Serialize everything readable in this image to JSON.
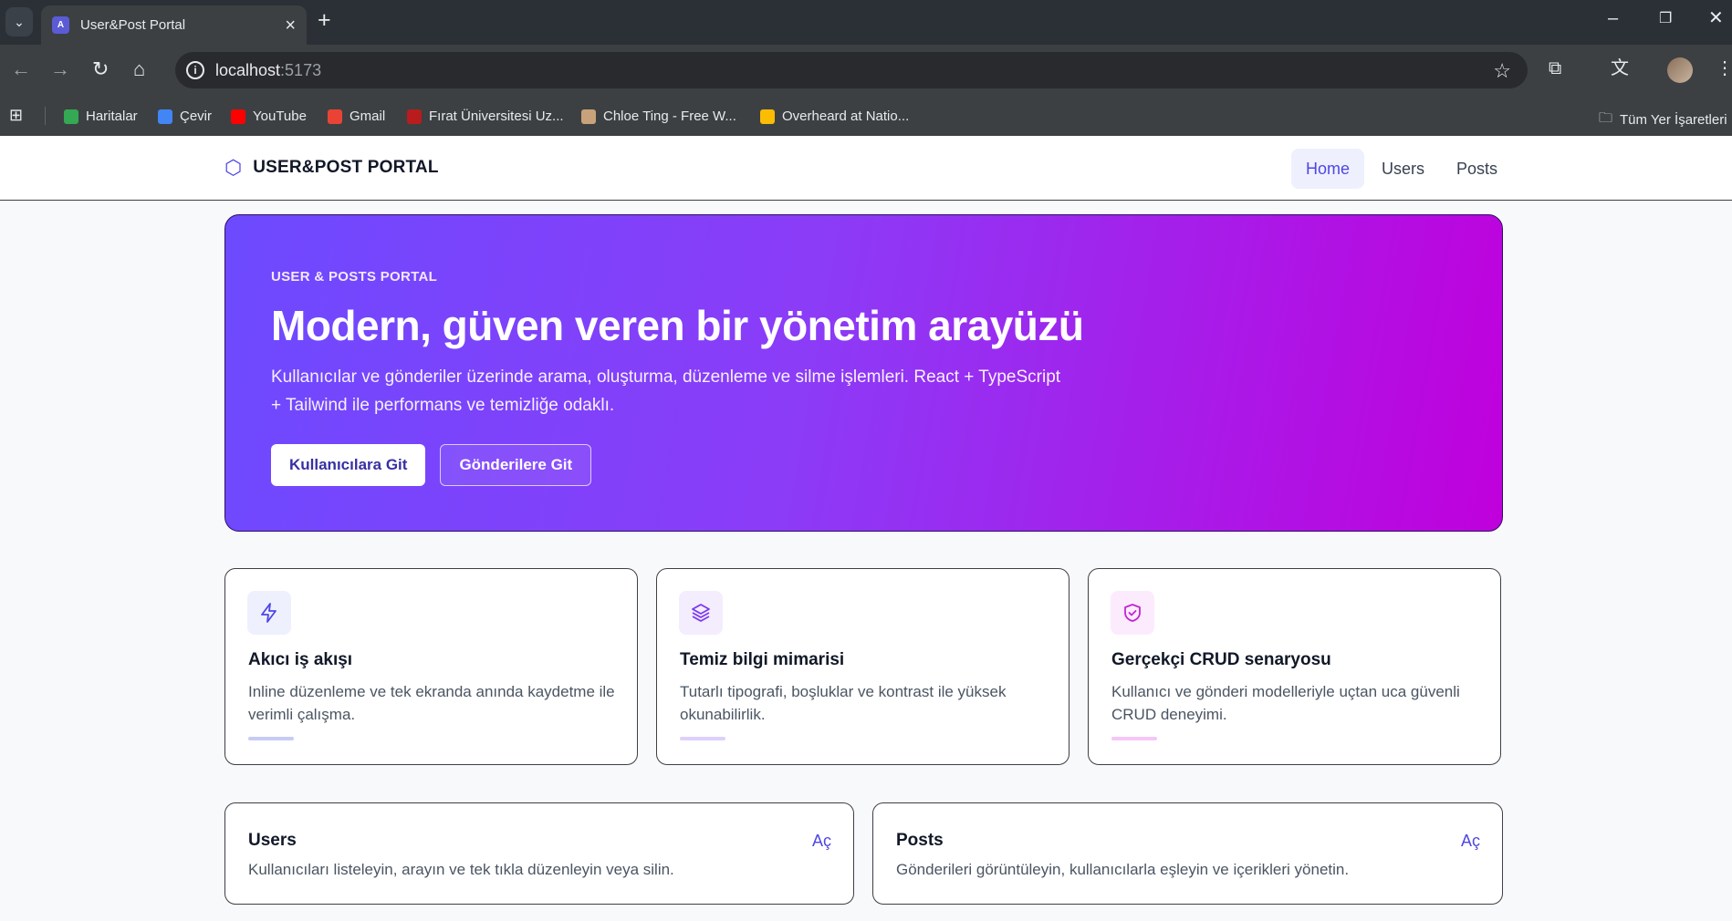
{
  "browser": {
    "tab_title": "User&Post Portal",
    "url_host": "localhost",
    "url_port": ":5173",
    "bookmarks": [
      {
        "label": "Haritalar",
        "icon": "maps-icon",
        "color": "#34a853"
      },
      {
        "label": "Çevir",
        "icon": "translate-icon",
        "color": "#4285f4"
      },
      {
        "label": "YouTube",
        "icon": "youtube-icon",
        "color": "#ff0000"
      },
      {
        "label": "Gmail",
        "icon": "gmail-icon",
        "color": "#ea4335"
      },
      {
        "label": "Fırat Üniversitesi Uz...",
        "icon": "university-icon",
        "color": "#b91c1c"
      },
      {
        "label": "Chloe Ting - Free W...",
        "icon": "chloe-ting-icon",
        "color": "#c8a27a"
      },
      {
        "label": "Overheard at Natio...",
        "icon": "natgeo-icon",
        "color": "#fbbc04"
      }
    ],
    "all_bookmarks_label": "Tüm Yer İşaretleri"
  },
  "header": {
    "brand": "USER&POST PORTAL",
    "nav": [
      {
        "label": "Home",
        "active": true
      },
      {
        "label": "Users",
        "active": false
      },
      {
        "label": "Posts",
        "active": false
      }
    ]
  },
  "hero": {
    "kicker": "USER & POSTS PORTAL",
    "title": "Modern, güven veren bir yönetim arayüzü",
    "description": "Kullanıcılar ve gönderiler üzerinde arama, oluşturma, düzenleme ve silme işlemleri. React + TypeScript + Tailwind ile performans ve temizliğe odaklı.",
    "primary_button": "Kullanıcılara Git",
    "secondary_button": "Gönderilere Git"
  },
  "features": [
    {
      "title": "Akıcı iş akışı",
      "description": "Inline düzenleme ve tek ekranda anında kaydetme ile verimli çalışma.",
      "icon": "bolt-icon",
      "accent": "#4f46e5",
      "tint": "#eef0fd",
      "bar": "#c7cbf5"
    },
    {
      "title": "Temiz bilgi mimarisi",
      "description": "Tutarlı tipografi, boşluklar ve kontrast ile yüksek okunabilirlik.",
      "icon": "layers-icon",
      "accent": "#7c3aed",
      "tint": "#f3edfe",
      "bar": "#ddd0fb"
    },
    {
      "title": "Gerçekçi CRUD senaryosu",
      "description": "Kullanıcı ve gönderi modelleriyle uçtan uca güvenli CRUD deneyimi.",
      "icon": "shield-check-icon",
      "accent": "#c026d3",
      "tint": "#fcebfd",
      "bar": "#f5c6f7"
    }
  ],
  "links": [
    {
      "title": "Users",
      "description": "Kullanıcıları listeleyin, arayın ve tek tıkla düzenleyin veya silin.",
      "action": "Aç"
    },
    {
      "title": "Posts",
      "description": "Gönderileri görüntüleyin, kullanıcılarla eşleyin ve içerikleri yönetin.",
      "action": "Aç"
    }
  ]
}
